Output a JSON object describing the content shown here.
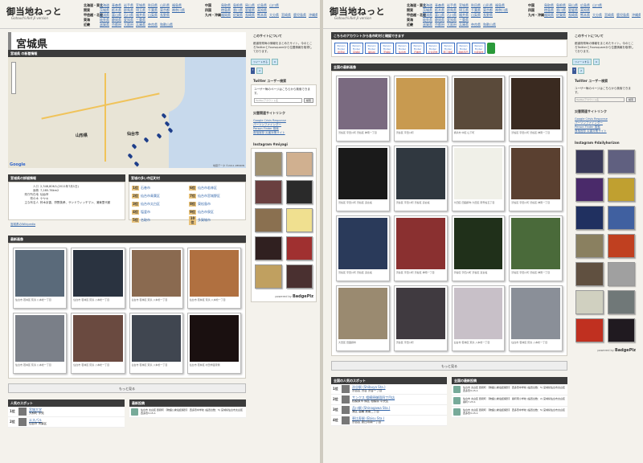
{
  "site": {
    "logo": "御当地ねっと",
    "logo_sub": "Gotouchi.Net β version"
  },
  "header_regions": {
    "left": [
      {
        "region": "北海道・東北",
        "prefs": [
          "北海道",
          "青森県",
          "岩手県",
          "宮城県",
          "秋田県",
          "山形県",
          "福島県"
        ]
      },
      {
        "region": "関東",
        "prefs": [
          "茨城県",
          "栃木県",
          "群馬県",
          "埼玉県",
          "千葉県",
          "東京都",
          "神奈川県"
        ]
      },
      {
        "region": "甲信越・北陸",
        "prefs": [
          "新潟県",
          "富山県",
          "石川県",
          "福井県",
          "山梨県",
          "長野県"
        ]
      },
      {
        "region": "東海",
        "prefs": [
          "岐阜県",
          "静岡県",
          "愛知県",
          "三重県"
        ]
      },
      {
        "region": "近畿",
        "prefs": [
          "滋賀県",
          "京都府",
          "大阪府",
          "兵庫県",
          "奈良県",
          "和歌山県"
        ]
      }
    ],
    "right": [
      {
        "region": "中国",
        "prefs": [
          "鳥取県",
          "島根県",
          "岡山県",
          "広島県",
          "山口県"
        ]
      },
      {
        "region": "四国",
        "prefs": [
          "徳島県",
          "香川県",
          "愛媛県",
          "高知県"
        ]
      },
      {
        "region": "九州・沖縄",
        "prefs": [
          "福岡県",
          "佐賀県",
          "長崎県",
          "熊本県",
          "大分県",
          "宮崎県",
          "鹿児島県",
          "沖縄県"
        ]
      }
    ]
  },
  "left_page": {
    "title": "宮城県",
    "news_bar": "宮城県 の新着情報",
    "map": {
      "city_sendai": "仙台市",
      "city_yamagata": "山形県",
      "google": "Google",
      "footer": "地図データ ©2011 ZENRIN"
    },
    "details_bar": "宮城県の詳細情報",
    "details": [
      {
        "k": "人口",
        "v": "2,348,806人(2011年7月1日)"
      },
      {
        "k": "面積",
        "v": "7,285.76km2"
      },
      {
        "k": "県庁所在地",
        "v": "仙台市"
      },
      {
        "k": "県の木",
        "v": "ケヤキ"
      },
      {
        "k": "主な有名人",
        "v": "鈴木京香、狩野英孝、サンドウィッチマン、浦東里代都"
      }
    ],
    "wiki_link": "宮城県のWikipedia",
    "rank_bar": "宮城の多い市区町村",
    "ranking": [
      {
        "n": "1位",
        "t": "石巻市"
      },
      {
        "n": "6位",
        "t": "仙台市若林区"
      },
      {
        "n": "2位",
        "t": "仙台市青葉区"
      },
      {
        "n": "7位",
        "t": "仙台市宮城野区"
      },
      {
        "n": "3位",
        "t": "仙台市太白区"
      },
      {
        "n": "8位",
        "t": "東松島市"
      },
      {
        "n": "4位",
        "t": "塩釜市"
      },
      {
        "n": "9位",
        "t": "仙台市泉区"
      },
      {
        "n": "5位",
        "t": "名取市"
      },
      {
        "n": "10位",
        "t": "多賀城市"
      }
    ],
    "photos_bar": "最新画像",
    "photos": [
      {
        "cap": "仙台市 若林区 荒浜 八本松一丁目",
        "c": "#5a6a7a"
      },
      {
        "cap": "仙台市 若林区 荒浜 八本松一丁目",
        "c": "#2a3340"
      },
      {
        "cap": "仙台市 若林区 荒浜 八本松一丁目",
        "c": "#8a6a50"
      },
      {
        "cap": "仙台市 若林区 荒浜 八本松一丁目",
        "c": "#b07040"
      },
      {
        "cap": "仙台市 若林区 荒浜 八本松一丁目",
        "c": "#7a7f88"
      },
      {
        "cap": "仙台市 若林区 荒浜 八本松一丁目",
        "c": "#6a4a40"
      },
      {
        "cap": "仙台市 若林区 荒浜 八本松一丁目",
        "c": "#404650"
      },
      {
        "cap": "仙台市 若林区 村田学園東側",
        "c": "#1a1010"
      }
    ],
    "more": "もっと見る",
    "spots_bar": "人気のスポット",
    "spots": [
      {
        "rank": "1位",
        "name": "宮城大学",
        "loc": "大和町 学苑"
      },
      {
        "rank": "2位",
        "name": "エスパル",
        "loc": "仙台市 青葉区"
      }
    ],
    "posts_bar": "最新投稿",
    "posts": [
      {
        "text": "仙台市 太白区 昼間町 【物語公衆電話撮影】 西多賀中学校 (設置台数：5) 宮城県仙台市太白区西多賀3-15-1"
      }
    ]
  },
  "right_page": {
    "account_bar": "こちらのアカウントから各市町村と確認できます",
    "pf_label": "Person Finder",
    "pf_places": [
      "岩手県",
      "宮城県",
      "福島県",
      "茨城県",
      "仙台市",
      "石巻市",
      "気仙沼市",
      "南三陸町",
      "陸前高田",
      "大船渡市"
    ],
    "photos_bar": "全国の最新画像",
    "photos": [
      {
        "cap": "渋谷区 宇田川町 渋谷区 神南一丁目",
        "c": "#7a6a80"
      },
      {
        "cap": "渋谷区 宇田川町",
        "c": "#c89a50"
      },
      {
        "cap": "横浜市 中区 山下町",
        "c": "#5a4a3a"
      },
      {
        "cap": "渋谷区 宇田川町 渋谷区 神南一丁目",
        "c": "#3a2a20"
      },
      {
        "cap": "渋谷区 宇田川町 渋谷区 道玄坂",
        "c": "#1a1a1a"
      },
      {
        "cap": "渋谷区 宇田川町 渋谷区 道玄坂",
        "c": "#303840"
      },
      {
        "cap": "大田区 田園調布 大田区 南雪谷五丁目",
        "c": "#f0f0e8"
      },
      {
        "cap": "渋谷区 宇田川町 渋谷区 神南一丁目",
        "c": "#5a4030"
      },
      {
        "cap": "渋谷区 宇田川町 渋谷区 道玄坂",
        "c": "#2a3a5a"
      },
      {
        "cap": "渋谷区 宇田川町 渋谷区 神南一丁目",
        "c": "#8a3030"
      },
      {
        "cap": "渋谷区 宇田川町 渋谷区 道玄坂",
        "c": "#20301a"
      },
      {
        "cap": "渋谷区 宇田川町 渋谷区 神南一丁目",
        "c": "#4a6a3a"
      },
      {
        "cap": "大田区 田園調布",
        "c": "#9a8a70"
      },
      {
        "cap": "渋谷区 宇田川町",
        "c": "#403a40"
      },
      {
        "cap": "仙台市 若林区 荒浜 八本松一丁目",
        "c": "#c8c0c8"
      },
      {
        "cap": "仙台市 若林区 荒浜 八本松一丁目",
        "c": "#8a8f98"
      }
    ],
    "more": "もっと見る",
    "spots_bar": "全国の人気のスポット",
    "spots": [
      {
        "rank": "1位",
        "name": "渋谷駅 (Shibuya Sta.)",
        "loc": "渋谷区 渋谷 渋谷一丁目"
      },
      {
        "rank": "2位",
        "name": "サンクス 相模原御園四丁目店",
        "loc": "相模原市 緑区 相模原 中央区"
      },
      {
        "rank": "3位",
        "name": "品川駅 (Shinagawa Sta.)",
        "loc": "港区 高輪 港南二丁目"
      },
      {
        "rank": "4位",
        "name": "恵比寿駅 (Ebisu Sta.)",
        "loc": "渋谷区 恵比寿南一丁目"
      }
    ],
    "posts_bar": "全国の最新投稿",
    "posts": [
      {
        "text": "仙台市 太白区 昼間町 【物語公衆電話撮影】 西多賀中学校 (設置台数：5) 宮城県仙台市太白区西多賀3-15-1"
      },
      {
        "text": "仙台市 太白区 昼間町 【物語公衆電話撮影】 長町南小学校 (設置台数：2) 宮城県仙台市太白区長町7-23-1"
      },
      {
        "text": "仙台市 太白区 昼間町 【物語公衆電話撮影】 西多賀中学校 (設置台数：5) 宮城県仙台市太白区西多賀3-15-1"
      }
    ]
  },
  "sidebar": {
    "about_bar": "このサイトについて",
    "about_text": "都道府県毎の情報をまとめたサイト。今のところTwitterとFoursquareから位置情報を取得しております。",
    "tweet": "ツイートする",
    "tweet_count": "0",
    "like_count": "2",
    "twitter_bar": "Twitter ユーザー検索",
    "twitter_text": "ユーザー毎のページはこちらから検索できます。",
    "twitter_placeholder": "Twitterアカウント名",
    "search_btn": "検索",
    "links_bar": "災害関連サイトリンク",
    "links": [
      "Google Crisis Response",
      "パーソンファインダー",
      "Person Finder 検索",
      "首相官邸 災害対策サイト"
    ],
    "ig_bar": "Instagram #miyagi",
    "ig_bar_right": "Instagram #dailyhorizon",
    "ig_left": [
      "#a09070",
      "#d0b090",
      "#6a4040",
      "#2a2a2a",
      "#8a7050",
      "#f0e090",
      "#302020",
      "#a03030",
      "#c0a060",
      "#4a3030"
    ],
    "ig_right": [
      "#3a3a5a",
      "#606080",
      "#4a2a6a",
      "#c0a030",
      "#203060",
      "#4060a0",
      "#8a8060",
      "#c04020",
      "#605040",
      "#a0a0a0",
      "#d0d0c0",
      "#707878",
      "#c03020",
      "#201a20"
    ],
    "powered": "powered by",
    "badge": "BadgePlz"
  }
}
